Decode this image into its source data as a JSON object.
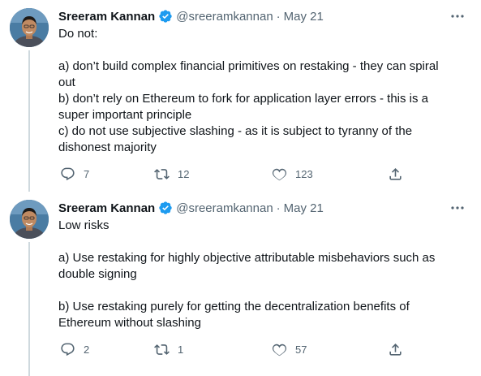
{
  "tweets": [
    {
      "author": "Sreeram Kannan",
      "handle": "@sreeramkannan",
      "separator": "·",
      "date": "May 21",
      "lines": [
        "Do not:",
        "",
        "a) don’t build complex financial primitives on restaking - they can spiral",
        "out",
        "b) don’t rely on Ethereum to fork for application layer errors - this is a",
        "super important principle",
        "c) do not use subjective slashing - as it is subject to tyranny of the",
        "dishonest majority"
      ],
      "replies": "7",
      "retweets": "12",
      "likes": "123"
    },
    {
      "author": "Sreeram Kannan",
      "handle": "@sreeramkannan",
      "separator": "·",
      "date": "May 21",
      "lines": [
        "Low risks",
        "",
        "a) Use restaking for highly objective attributable misbehaviors such as",
        "double signing",
        "",
        "b) Use restaking purely for getting the decentralization benefits of",
        "Ethereum without slashing"
      ],
      "replies": "2",
      "retweets": "1",
      "likes": "57"
    }
  ],
  "icons": {
    "verified": "verified-badge-icon",
    "more": "more-icon",
    "reply": "reply-icon",
    "retweet": "retweet-icon",
    "like": "like-icon",
    "share": "share-icon"
  },
  "colors": {
    "verified": "#1d9bf0",
    "text": "#0f1419",
    "secondary": "#536471",
    "thread_line": "#cfd9de"
  }
}
